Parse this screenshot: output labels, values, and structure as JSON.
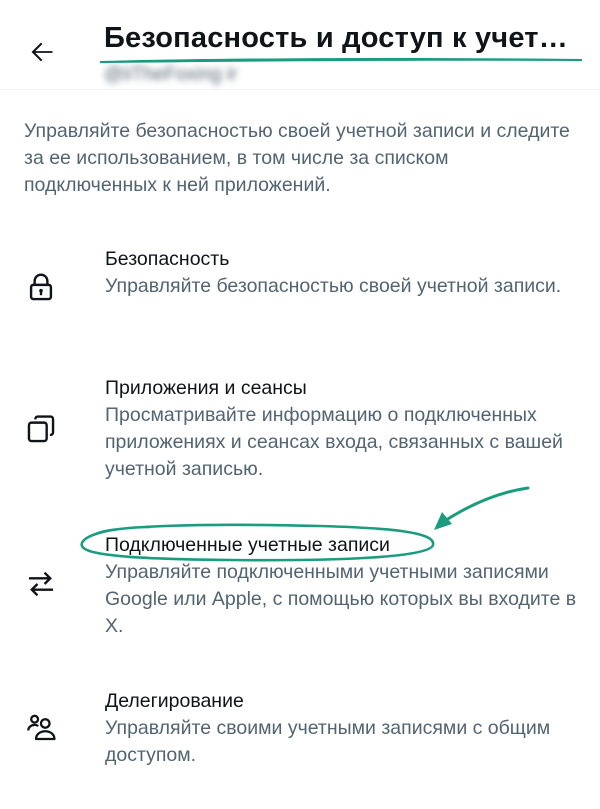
{
  "header": {
    "title": "Безопасность и доступ к учетно…",
    "username": "@iiTheFoxing ir"
  },
  "intro": "Управляйте безопасностью своей учетной записи и следите за ее использованием, в том числе за списком подключенных к ней приложений.",
  "items": [
    {
      "label": "Безопасность",
      "description": "Управляйте безопасностью своей учетной записи.",
      "icon": "lock-icon"
    },
    {
      "label": "Приложения и сеансы",
      "description": "Просматривайте информацию о подключенных приложениях и сеансах входа, связанных с вашей учетной записью.",
      "icon": "copy-squares-icon"
    },
    {
      "label": "Подключенные учетные записи",
      "description": "Управляйте подключенными учетными записями Google или Apple, с помощью которых вы входите в X.",
      "icon": "swap-arrows-icon"
    },
    {
      "label": "Делегирование",
      "description": "Управляйте своими учетными записями с общим доступом.",
      "icon": "people-icon"
    }
  ],
  "colors": {
    "primary_text": "#0f1419",
    "secondary_text": "#536471",
    "annotation": "#1a9c7f"
  }
}
